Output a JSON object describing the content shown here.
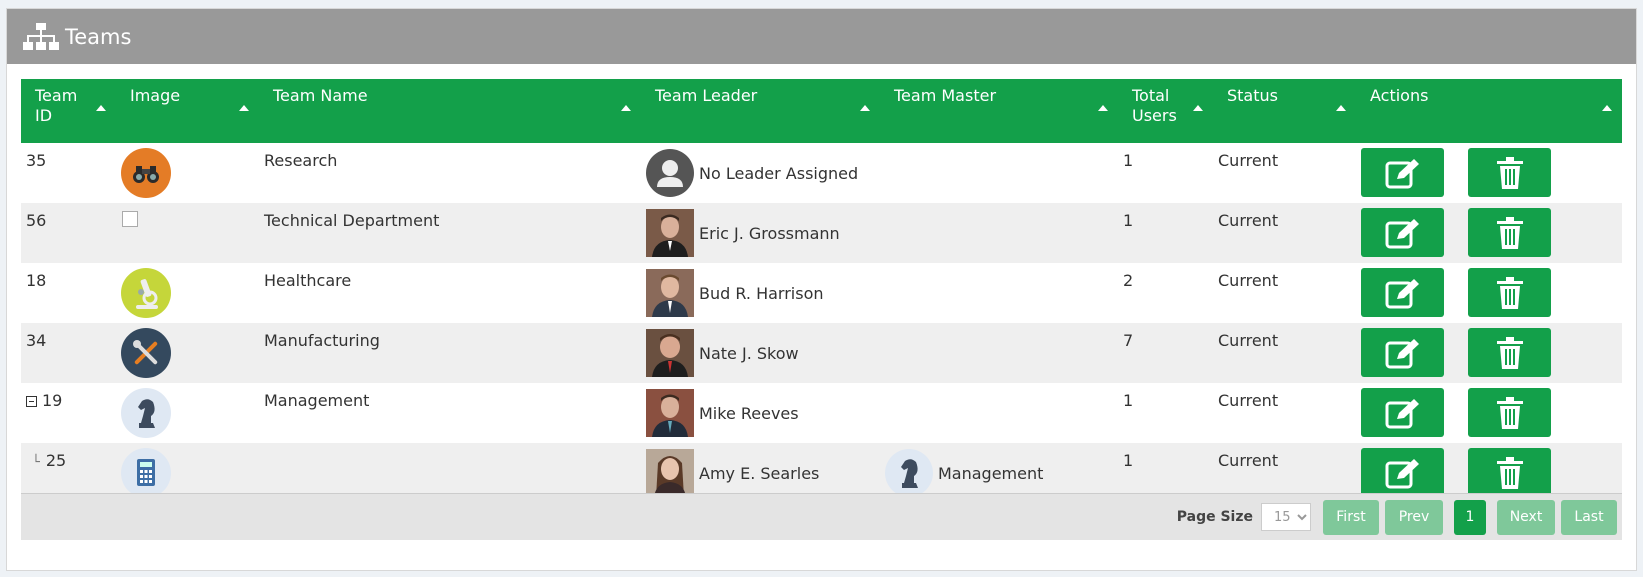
{
  "header": {
    "title": "Teams"
  },
  "columns": [
    {
      "label": "Team ID"
    },
    {
      "label": "Image"
    },
    {
      "label": "Team Name"
    },
    {
      "label": "Team Leader"
    },
    {
      "label": "Team Master"
    },
    {
      "label": "Total Users"
    },
    {
      "label": "Status"
    },
    {
      "label": "Actions"
    }
  ],
  "rows": [
    {
      "id": "35",
      "image_icon": "binoculars-icon",
      "name": "Research",
      "leader": "No Leader Assigned",
      "leader_photo": "default-user-icon",
      "master": "",
      "users": "1",
      "status": "Current"
    },
    {
      "id": "56",
      "image_icon": "empty-checkbox",
      "name": "Technical Department",
      "leader": "Eric J. Grossmann",
      "leader_photo": "photo",
      "master": "",
      "users": "1",
      "status": "Current"
    },
    {
      "id": "18",
      "image_icon": "microscope-icon",
      "name": "Healthcare",
      "leader": "Bud R. Harrison",
      "leader_photo": "photo",
      "master": "",
      "users": "2",
      "status": "Current"
    },
    {
      "id": "34",
      "image_icon": "tools-icon",
      "name": "Manufacturing",
      "leader": "Nate J. Skow",
      "leader_photo": "photo",
      "master": "",
      "users": "7",
      "status": "Current"
    },
    {
      "id": "19",
      "image_icon": "chess-knight-icon",
      "name": "Management",
      "leader": "Mike Reeves",
      "leader_photo": "photo",
      "master": "",
      "users": "1",
      "status": "Current"
    },
    {
      "id": "25",
      "image_icon": "calculator-icon",
      "name": "",
      "leader": "Amy E. Searles",
      "leader_photo": "photo",
      "master": "Management",
      "users": "1",
      "status": "Current"
    }
  ],
  "pager": {
    "page_size_label": "Page Size",
    "page_size_value": "15",
    "first": "First",
    "prev": "Prev",
    "current": "1",
    "next": "Next",
    "last": "Last"
  },
  "colors": {
    "accent": "#13a04a",
    "header_bg": "#999999",
    "pager_disabled": "#7fc89a"
  }
}
